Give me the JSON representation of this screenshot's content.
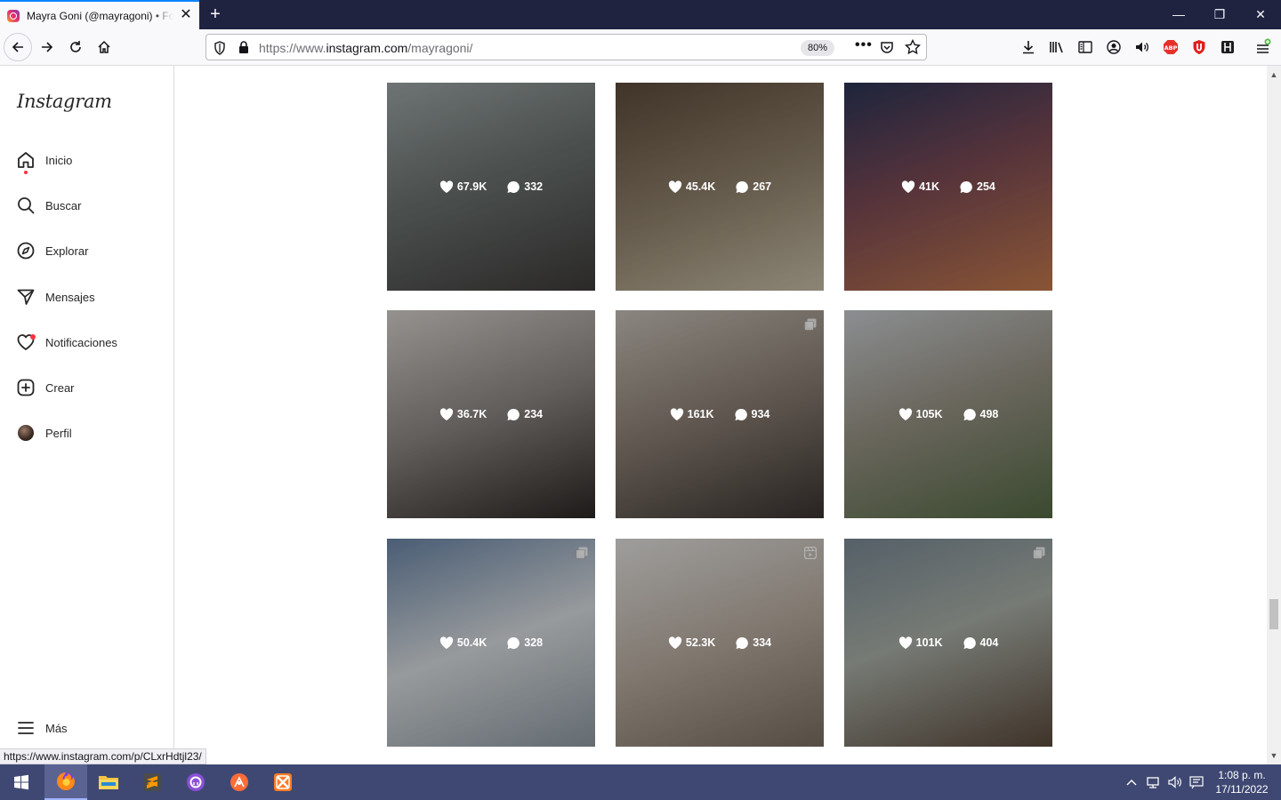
{
  "browser": {
    "tab_title": "Mayra Goni (@mayragoni) • Fotos y videos de Instagram",
    "new_tab_label": "+",
    "url_prefix": "https://www.",
    "url_domain": "instagram.com",
    "url_path": "/mayragoni/",
    "zoom": "80%",
    "page_actions": "•••",
    "status_link": "https://www.instagram.com/p/CLxrHdtjl23/",
    "colors": {
      "tab_bar": "#202340",
      "accent": "#0a84ff"
    }
  },
  "sidebar": {
    "logo": "Instagram",
    "items": [
      {
        "label": "Inicio",
        "icon": "home-icon",
        "badge": true
      },
      {
        "label": "Buscar",
        "icon": "search-icon"
      },
      {
        "label": "Explorar",
        "icon": "compass-icon"
      },
      {
        "label": "Mensajes",
        "icon": "send-icon"
      },
      {
        "label": "Notificaciones",
        "icon": "heart-icon",
        "badge": true
      },
      {
        "label": "Crear",
        "icon": "plus-square-icon"
      },
      {
        "label": "Perfil",
        "icon": "avatar"
      }
    ],
    "more_label": "Más"
  },
  "posts": [
    {
      "likes": "67.9K",
      "comments": "332",
      "type": "photo"
    },
    {
      "likes": "45.4K",
      "comments": "267",
      "type": "photo"
    },
    {
      "likes": "41K",
      "comments": "254",
      "type": "photo"
    },
    {
      "likes": "36.7K",
      "comments": "234",
      "type": "photo"
    },
    {
      "likes": "161K",
      "comments": "934",
      "type": "carousel"
    },
    {
      "likes": "105K",
      "comments": "498",
      "type": "photo"
    },
    {
      "likes": "50.4K",
      "comments": "328",
      "type": "carousel"
    },
    {
      "likes": "52.3K",
      "comments": "334",
      "type": "reel"
    },
    {
      "likes": "101K",
      "comments": "404",
      "type": "carousel"
    }
  ],
  "taskbar": {
    "apps": [
      "windows-start",
      "firefox",
      "file-explorer",
      "sublime-text",
      "github-desktop",
      "postman",
      "xampp"
    ],
    "clock_time": "1:08 p. m.",
    "clock_date": "17/11/2022"
  }
}
